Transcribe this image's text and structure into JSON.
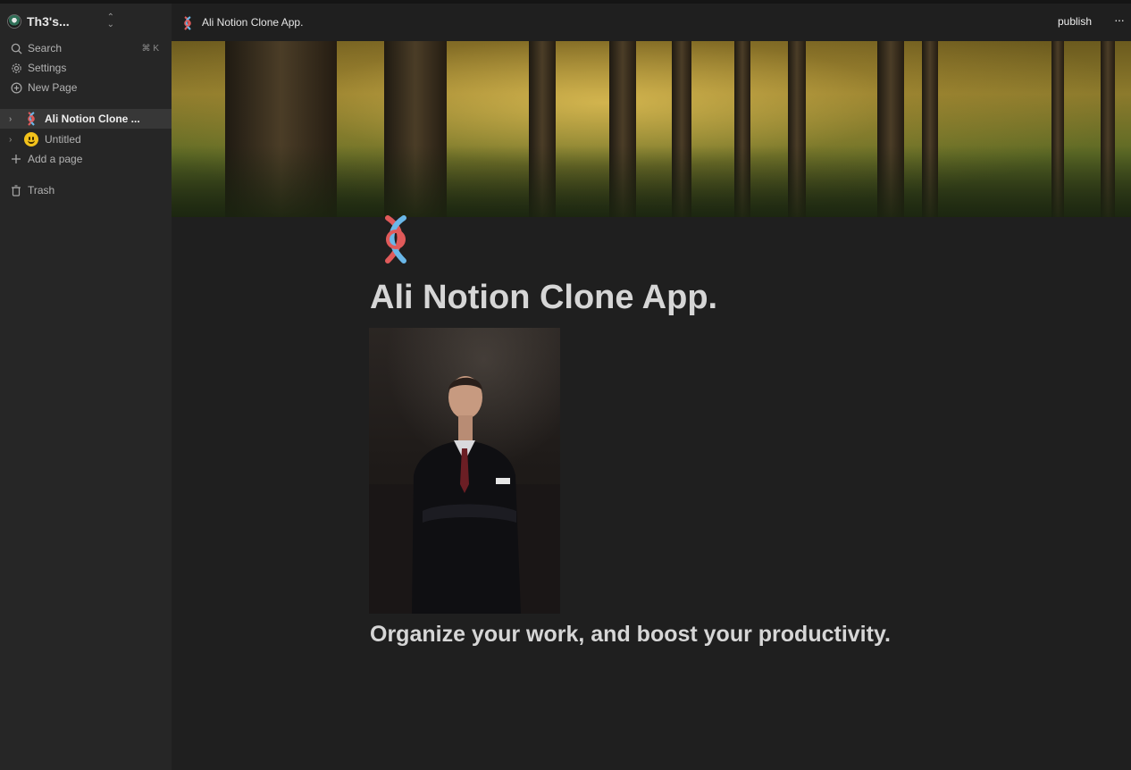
{
  "workspace": {
    "name": "Th3's...",
    "switch_icon": "chevron-up-down-icon"
  },
  "sidebar": {
    "actions": [
      {
        "label": "Search",
        "icon": "search-icon",
        "shortcut": "⌘ K"
      },
      {
        "label": "Settings",
        "icon": "gear-icon"
      },
      {
        "label": "New Page",
        "icon": "plus-circle-icon"
      }
    ],
    "pages": [
      {
        "label": "Ali Notion Clone ...",
        "icon": "knot-emoji-icon",
        "active": true
      },
      {
        "label": "Untitled",
        "icon": "smiley-emoji-icon",
        "active": false
      }
    ],
    "add_page": "Add a page",
    "trash": "Trash"
  },
  "topbar": {
    "breadcrumb_title": "Ali Notion Clone App.",
    "publish_label": "publish",
    "more_label": "···"
  },
  "page": {
    "title": "Ali Notion Clone App.",
    "subtitle": "Organize your work, and boost your productivity."
  },
  "colors": {
    "background": "#1f1f1f",
    "sidebar": "#262626",
    "active_row": "#373737"
  }
}
